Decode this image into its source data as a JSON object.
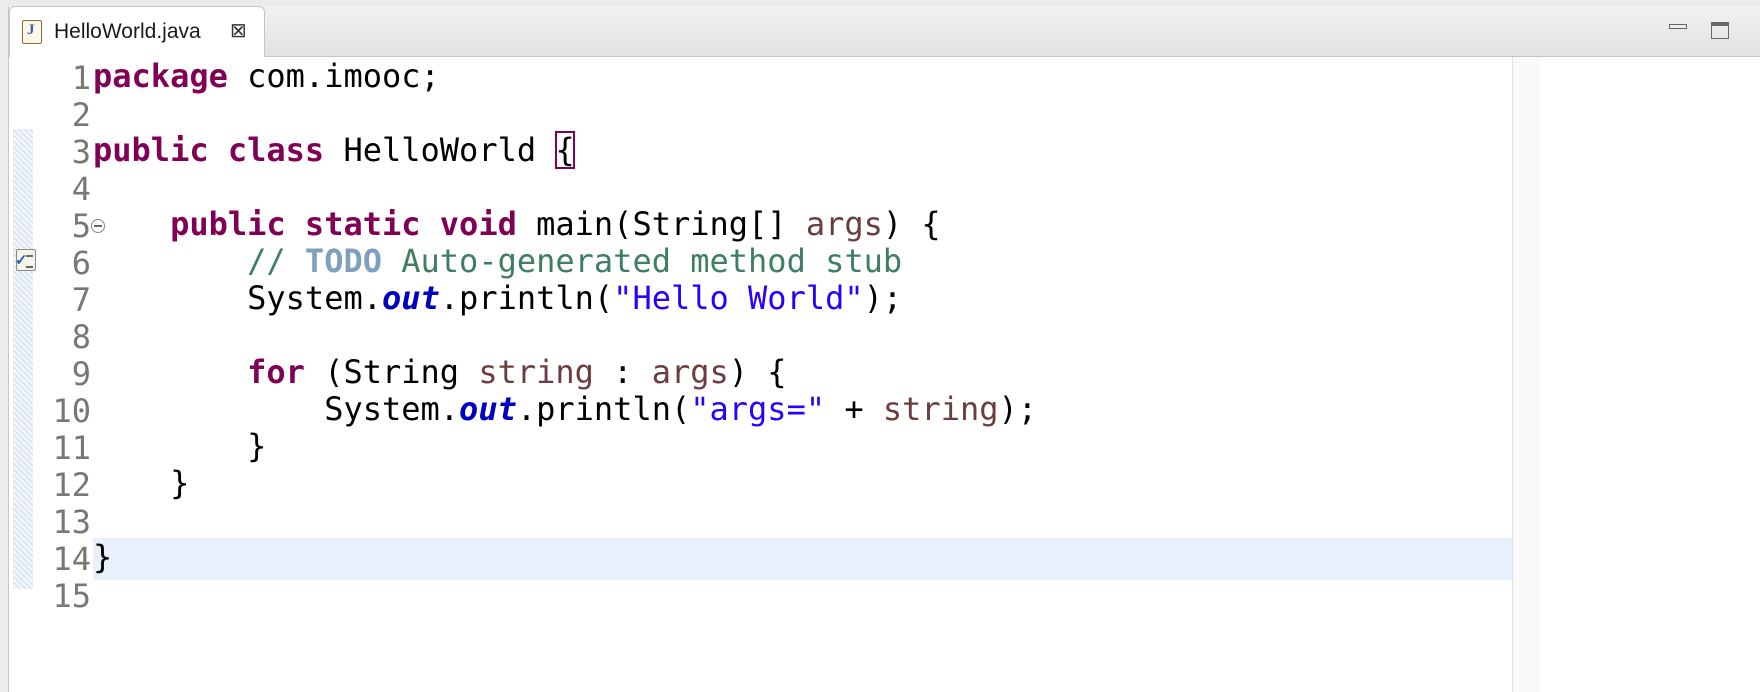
{
  "tab": {
    "title": "HelloWorld.java",
    "icon": "java-file-icon",
    "icon_letter": "J",
    "close_glyph": "⊠"
  },
  "colors": {
    "keyword": "#7f0055",
    "comment": "#3f7f5f",
    "todo": "#7f9fbf",
    "string": "#2a00ff",
    "field": "#0000c0",
    "variable": "#6a3e3e",
    "current_line": "#e8f0fb"
  },
  "editor": {
    "current_line": 14,
    "line_numbers": [
      "1",
      "2",
      "3",
      "4",
      "5",
      "6",
      "7",
      "8",
      "9",
      "10",
      "11",
      "12",
      "13",
      "14",
      "15"
    ],
    "code": {
      "l1": {
        "kw": "package",
        "rest": " com.imooc;"
      },
      "l3": {
        "kw1": "public",
        "kw2": "class",
        "name": " HelloWorld ",
        "brace": "{"
      },
      "l5": {
        "indent": "    ",
        "kw1": "public",
        "kw2": "static",
        "kw3": "void",
        "rest": " main(String[] ",
        "var": "args",
        "end": ") {"
      },
      "l6": {
        "indent": "        ",
        "comment_start": "// ",
        "todo": "TODO",
        "comment_rest": " Auto-generated method stub"
      },
      "l7": {
        "indent": "        ",
        "pre": "System.",
        "field": "out",
        "mid": ".println(",
        "str": "\"Hello World\"",
        "end": ");"
      },
      "l9": {
        "indent": "        ",
        "kw": "for",
        "pre": " (String ",
        "var1": "string",
        "sep": " : ",
        "var2": "args",
        "end": ") {"
      },
      "l10": {
        "indent": "            ",
        "pre": "System.",
        "field": "out",
        "mid": ".println(",
        "str": "\"args=\"",
        "plus": " + ",
        "var": "string",
        "end": ");"
      },
      "l11": {
        "text": "        }"
      },
      "l12": {
        "text": "    }"
      },
      "l14": {
        "text": "}"
      }
    }
  }
}
